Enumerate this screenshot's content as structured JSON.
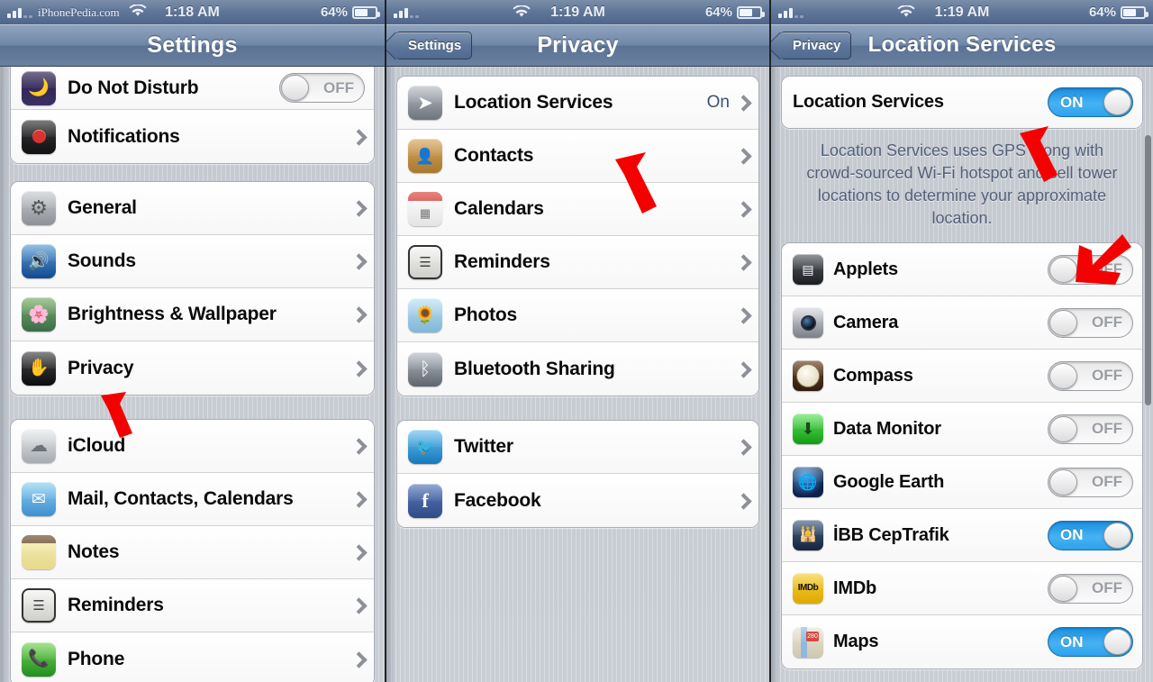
{
  "panels": [
    {
      "status": {
        "carrier": "iPhonePedia.com",
        "time": "1:18 AM",
        "battery": "64%"
      },
      "nav": {
        "title": "Settings",
        "back": null
      },
      "groups": [
        {
          "rows": [
            {
              "label": "Do Not Disturb",
              "icon": "do-not-disturb-icon",
              "control": "toggle",
              "state": "OFF"
            },
            {
              "label": "Notifications",
              "icon": "notifications-icon",
              "control": "chevron"
            }
          ]
        },
        {
          "rows": [
            {
              "label": "General",
              "icon": "general-gear-icon",
              "control": "chevron"
            },
            {
              "label": "Sounds",
              "icon": "sounds-speaker-icon",
              "control": "chevron"
            },
            {
              "label": "Brightness & Wallpaper",
              "icon": "brightness-wallpaper-icon",
              "control": "chevron"
            },
            {
              "label": "Privacy",
              "icon": "privacy-hand-icon",
              "control": "chevron"
            }
          ]
        },
        {
          "rows": [
            {
              "label": "iCloud",
              "icon": "icloud-icon",
              "control": "chevron"
            },
            {
              "label": "Mail, Contacts, Calendars",
              "icon": "mail-icon",
              "control": "chevron"
            },
            {
              "label": "Notes",
              "icon": "notes-icon",
              "control": "chevron"
            },
            {
              "label": "Reminders",
              "icon": "reminders-icon",
              "control": "chevron"
            },
            {
              "label": "Phone",
              "icon": "phone-icon",
              "control": "chevron"
            }
          ]
        }
      ]
    },
    {
      "status": {
        "carrier": "",
        "time": "1:19 AM",
        "battery": "64%"
      },
      "nav": {
        "title": "Privacy",
        "back": "Settings"
      },
      "groups": [
        {
          "rows": [
            {
              "label": "Location Services",
              "icon": "location-arrow-icon",
              "control": "chevron",
              "value": "On"
            },
            {
              "label": "Contacts",
              "icon": "contacts-icon",
              "control": "chevron"
            },
            {
              "label": "Calendars",
              "icon": "calendars-icon",
              "control": "chevron"
            },
            {
              "label": "Reminders",
              "icon": "reminders-icon",
              "control": "chevron"
            },
            {
              "label": "Photos",
              "icon": "photos-icon",
              "control": "chevron"
            },
            {
              "label": "Bluetooth Sharing",
              "icon": "bluetooth-icon",
              "control": "chevron"
            }
          ]
        },
        {
          "rows": [
            {
              "label": "Twitter",
              "icon": "twitter-icon",
              "control": "chevron"
            },
            {
              "label": "Facebook",
              "icon": "facebook-icon",
              "control": "chevron"
            }
          ]
        }
      ]
    },
    {
      "status": {
        "carrier": "",
        "time": "1:19 AM",
        "battery": "64%"
      },
      "nav": {
        "title": "Location Services",
        "back": "Privacy"
      },
      "master": {
        "label": "Location Services",
        "state": "ON"
      },
      "footnote": "Location Services uses GPS along with crowd-sourced Wi-Fi hotspot and cell tower locations to determine your approximate location.",
      "groups": [
        {
          "rows": [
            {
              "label": "Applets",
              "icon": "applets-icon",
              "control": "toggle",
              "state": "OFF"
            },
            {
              "label": "Camera",
              "icon": "camera-icon",
              "control": "toggle",
              "state": "OFF"
            },
            {
              "label": "Compass",
              "icon": "compass-icon",
              "control": "toggle",
              "state": "OFF"
            },
            {
              "label": "Data Monitor",
              "icon": "data-monitor-icon",
              "control": "toggle",
              "state": "OFF"
            },
            {
              "label": "Google Earth",
              "icon": "google-earth-icon",
              "control": "toggle",
              "state": "OFF"
            },
            {
              "label": "İBB CepTrafik",
              "icon": "ibb-ceptrafik-icon",
              "control": "toggle",
              "state": "ON"
            },
            {
              "label": "IMDb",
              "icon": "imdb-icon",
              "control": "toggle",
              "state": "OFF"
            },
            {
              "label": "Maps",
              "icon": "maps-icon",
              "control": "toggle",
              "state": "ON"
            }
          ]
        }
      ]
    }
  ],
  "annotations": {
    "color": "#f50000",
    "arrows": [
      {
        "name": "arrow-to-privacy",
        "points": "up"
      },
      {
        "name": "arrow-to-location-services",
        "points": "up"
      },
      {
        "name": "arrow-to-location-toggle",
        "points": "up"
      },
      {
        "name": "arrow-to-app-list",
        "points": "down-left"
      }
    ]
  }
}
